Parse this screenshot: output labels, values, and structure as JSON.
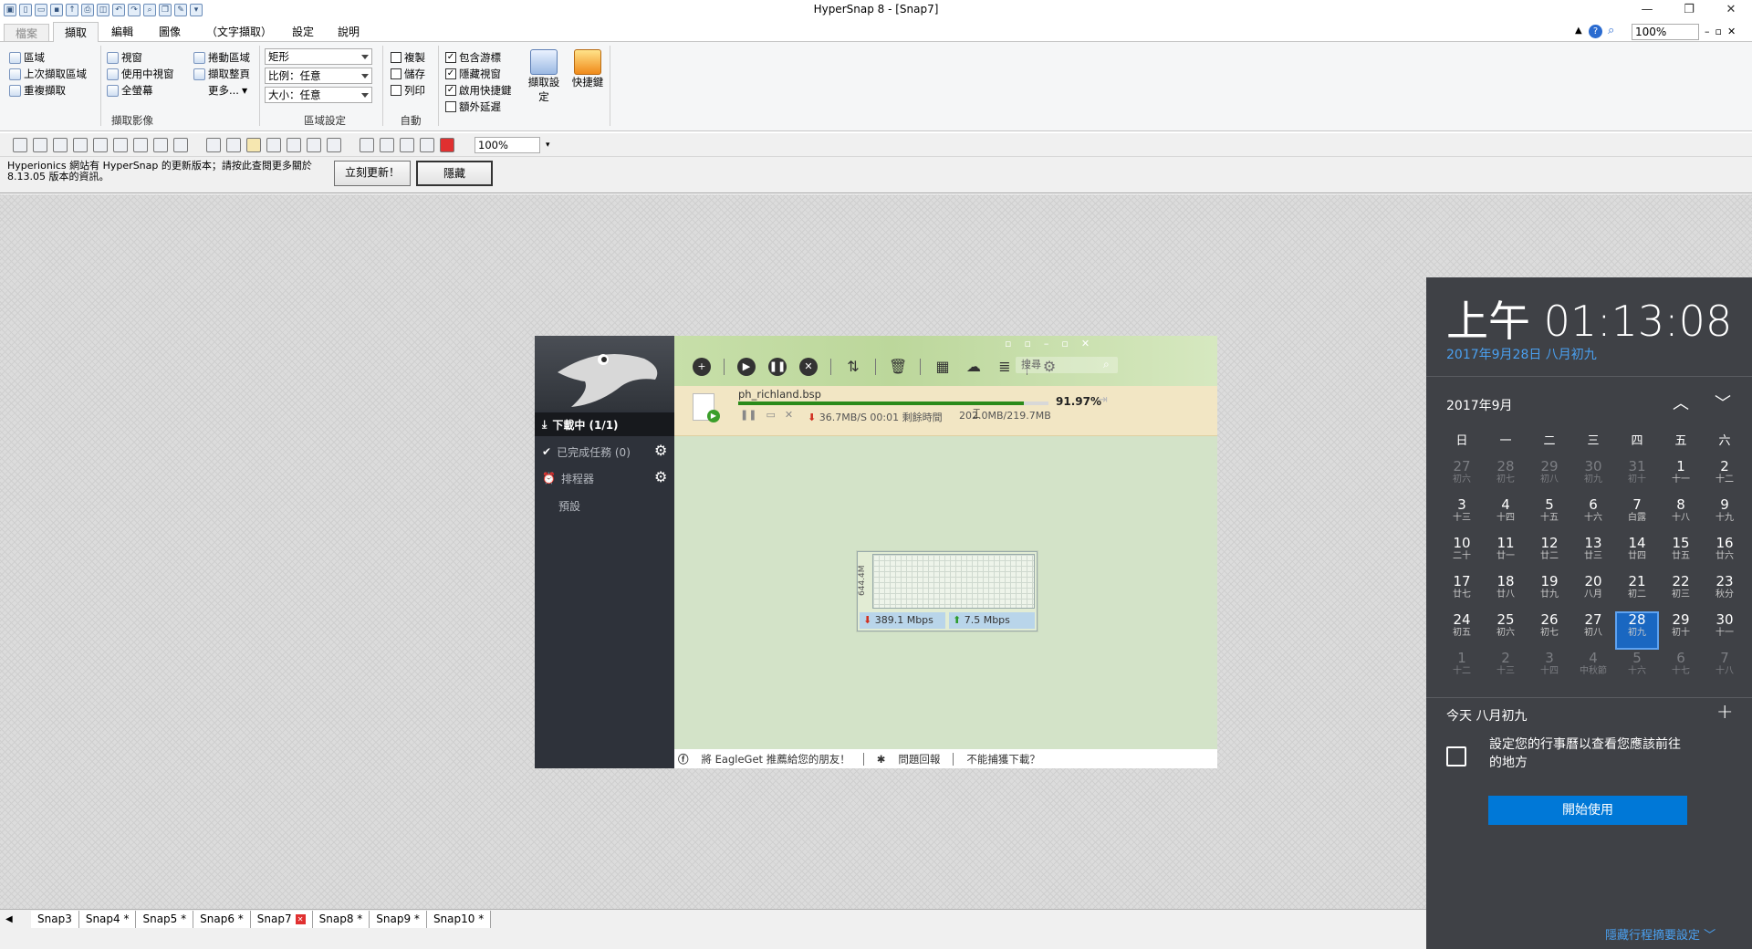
{
  "window": {
    "title": "HyperSnap 8 - [Snap7]"
  },
  "ribbon": {
    "tabs": [
      "檔案",
      "擷取",
      "編輯",
      "圖像",
      "（文字擷取）",
      "設定",
      "說明"
    ],
    "active_tab": "擷取",
    "zoom": "100%",
    "group_capture": {
      "label": "擷取影像",
      "items": [
        "區域",
        "上次擷取區域",
        "重複擷取",
        "視窗",
        "使用中視窗",
        "全螢幕",
        "捲動區域",
        "擷取整頁",
        "更多..."
      ]
    },
    "group_region": {
      "label": "區域設定",
      "shape": "矩形",
      "ratio": "比例：任意",
      "size": "大小：任意"
    },
    "group_auto": {
      "label": "自動",
      "items": [
        "複製",
        "儲存",
        "列印"
      ]
    },
    "group_options": {
      "items": [
        "包含游標",
        "隱藏視窗",
        "啟用快捷鍵",
        "額外延遲"
      ]
    },
    "btn_capture_settings": "擷取設定",
    "btn_hotkeys": "快捷鍵"
  },
  "toolbar2": {
    "zoom": "100%"
  },
  "notice": {
    "text": "Hyperionics 網站有 HyperSnap 的更新版本；請按此查閱更多關於 8.13.05 版本的資訊。",
    "update_button": "立刻更新！",
    "hide_button": "隱藏"
  },
  "eagleget": {
    "sidebar": {
      "downloading": "下載中 (1/1)",
      "completed": "已完成任務 (0)",
      "scheduler": "排程器",
      "default": "預設"
    },
    "search_placeholder": "搜尋",
    "task": {
      "filename": "ph_richland.bsp",
      "percent": "91.97%",
      "progress": 0.9197,
      "speed": "36.7MB/S 00:01 剩餘時間",
      "size": "202.0MB/219.7MB"
    },
    "footer": {
      "recommend": "將 EagleGet 推薦給您的朋友！",
      "feedback": "問題回報",
      "cannot_capture": "不能捕獲下載？"
    },
    "mini": {
      "axis": "644.4M",
      "down": "389.1 Mbps",
      "up": "7.5 Mbps"
    }
  },
  "snap_tabs": [
    {
      "label": "Snap3",
      "active": false
    },
    {
      "label": "Snap4 *",
      "active": false
    },
    {
      "label": "Snap5 *",
      "active": false
    },
    {
      "label": "Snap6 *",
      "active": false
    },
    {
      "label": "Snap7",
      "active": true
    },
    {
      "label": "Snap8 *",
      "active": false
    },
    {
      "label": "Snap9 *",
      "active": false
    },
    {
      "label": "Snap10 *",
      "active": false
    }
  ],
  "calendar": {
    "time": "上午 01:13:08",
    "date": "2017年9月28日 八月初九",
    "month": "2017年9月",
    "weekdays": [
      "日",
      "一",
      "二",
      "三",
      "四",
      "五",
      "六"
    ],
    "days": [
      [
        "27",
        "初六",
        1
      ],
      [
        "28",
        "初七",
        1
      ],
      [
        "29",
        "初八",
        1
      ],
      [
        "30",
        "初九",
        1
      ],
      [
        "31",
        "初十",
        1
      ],
      [
        "1",
        "十一",
        0
      ],
      [
        "2",
        "十二",
        0
      ],
      [
        "3",
        "十三",
        0
      ],
      [
        "4",
        "十四",
        0
      ],
      [
        "5",
        "十五",
        0
      ],
      [
        "6",
        "十六",
        0
      ],
      [
        "7",
        "白露",
        0
      ],
      [
        "8",
        "十八",
        0
      ],
      [
        "9",
        "十九",
        0
      ],
      [
        "10",
        "二十",
        0
      ],
      [
        "11",
        "廿一",
        0
      ],
      [
        "12",
        "廿二",
        0
      ],
      [
        "13",
        "廿三",
        0
      ],
      [
        "14",
        "廿四",
        0
      ],
      [
        "15",
        "廿五",
        0
      ],
      [
        "16",
        "廿六",
        0
      ],
      [
        "17",
        "廿七",
        0
      ],
      [
        "18",
        "廿八",
        0
      ],
      [
        "19",
        "廿九",
        0
      ],
      [
        "20",
        "八月",
        0
      ],
      [
        "21",
        "初二",
        0
      ],
      [
        "22",
        "初三",
        0
      ],
      [
        "23",
        "秋分",
        0
      ],
      [
        "24",
        "初五",
        0
      ],
      [
        "25",
        "初六",
        0
      ],
      [
        "26",
        "初七",
        0
      ],
      [
        "27",
        "初八",
        0
      ],
      [
        "28",
        "初九",
        2
      ],
      [
        "29",
        "初十",
        0
      ],
      [
        "30",
        "十一",
        0
      ],
      [
        "1",
        "十二",
        1
      ],
      [
        "2",
        "十三",
        1
      ],
      [
        "3",
        "十四",
        1
      ],
      [
        "4",
        "中秋節",
        1
      ],
      [
        "5",
        "十六",
        1
      ],
      [
        "6",
        "十七",
        1
      ],
      [
        "7",
        "十八",
        1
      ]
    ],
    "today_label": "今天 八月初九",
    "agenda_text": "設定您的行事曆以查看您應該前往的地方",
    "start_button": "開始使用",
    "hide_agenda": "隱藏行程摘要設定"
  },
  "colors": {
    "accent": "#0078d7",
    "calendar_bg": "#3f4146",
    "eg_bg": "#d3e3c8",
    "eg_progress": "#2a8a1a"
  }
}
